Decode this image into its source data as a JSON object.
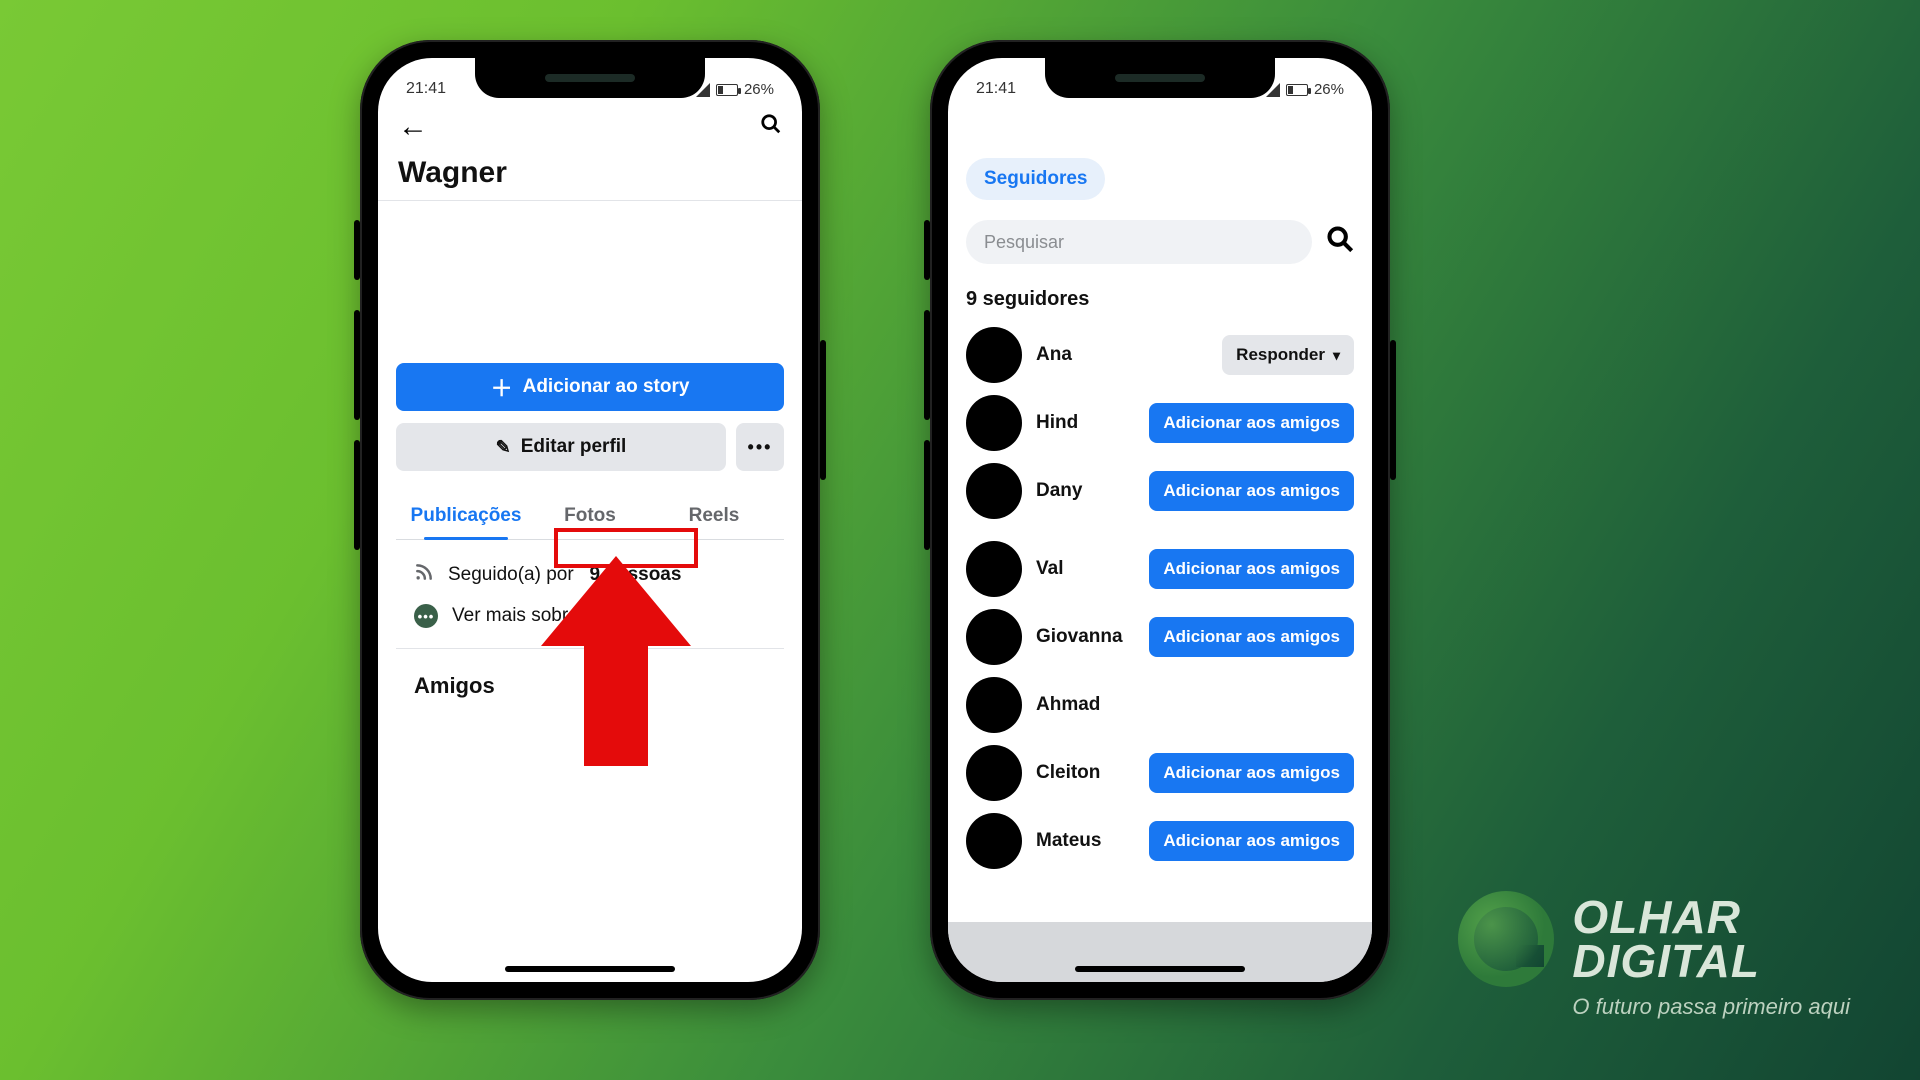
{
  "status": {
    "time": "21:41",
    "battery": "26%"
  },
  "phone1": {
    "profile_name": "Wagner",
    "add_story": "Adicionar ao story",
    "edit_profile": "Editar perfil",
    "tabs": {
      "posts": "Publicações",
      "photos": "Fotos",
      "reels": "Reels"
    },
    "followed_prefix": "Seguido(a) por",
    "followed_count": "9 pessoas",
    "see_more": "Ver mais sobre você",
    "friends_section": "Amigos"
  },
  "phone2": {
    "chip": "Seguidores",
    "search_placeholder": "Pesquisar",
    "count_label": "9 seguidores",
    "respond": "Responder",
    "add_friend": "Adicionar aos amigos",
    "people": [
      {
        "name": "Ana",
        "action": "respond"
      },
      {
        "name": "Hind",
        "action": "add"
      },
      {
        "name": "Dany",
        "action": "add"
      },
      {
        "name": "Val",
        "action": "add"
      },
      {
        "name": "Giovanna",
        "action": "add"
      },
      {
        "name": "Ahmad",
        "action": "none"
      },
      {
        "name": "Cleiton",
        "action": "add"
      },
      {
        "name": "Mateus",
        "action": "add"
      }
    ]
  },
  "brand": {
    "line1": "OLHAR",
    "line2": "DIGITAL",
    "tagline": "O futuro passa primeiro aqui"
  }
}
